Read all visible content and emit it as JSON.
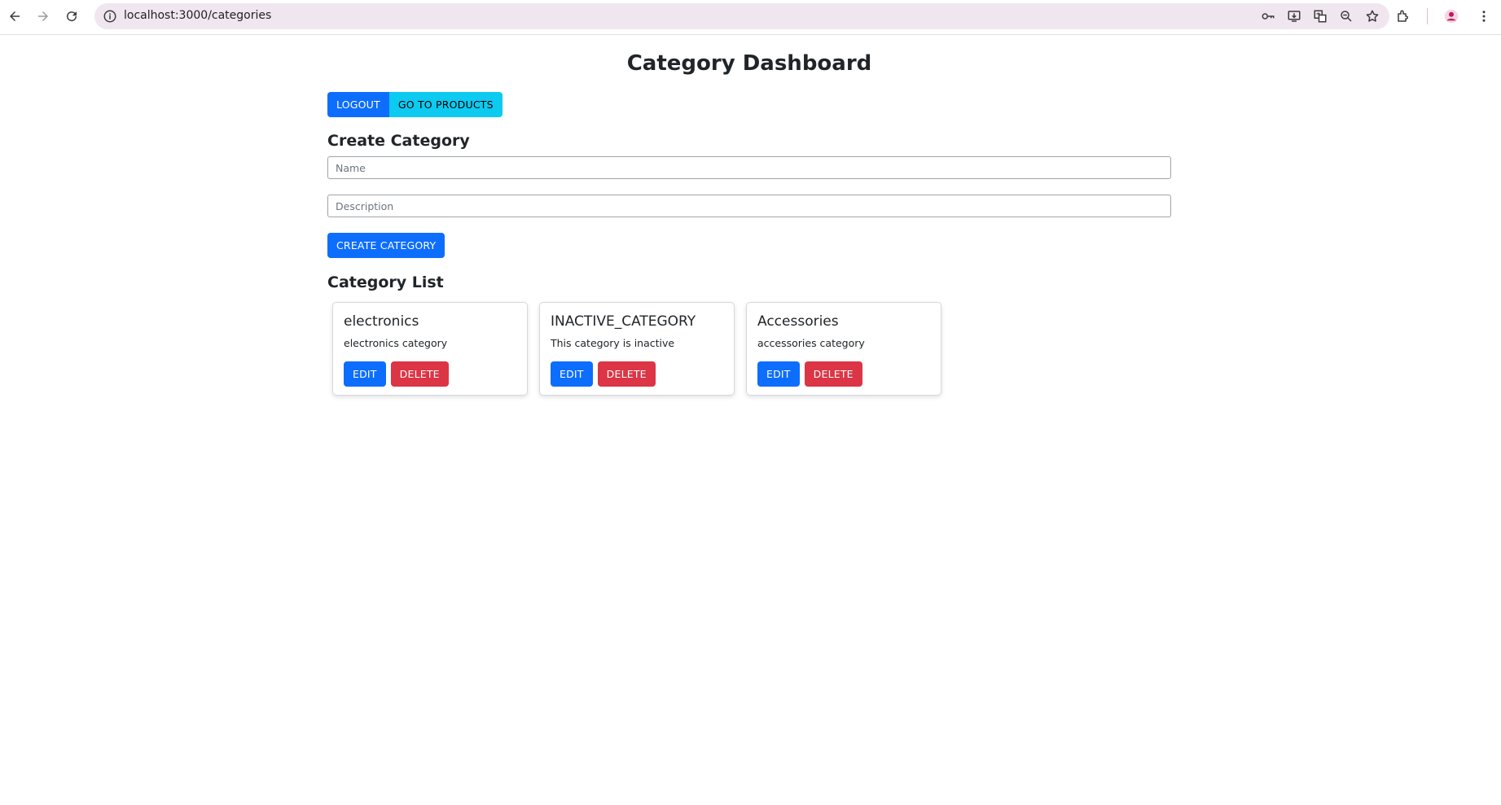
{
  "browser": {
    "url": "localhost:3000/categories",
    "icons": [
      "back-icon",
      "forward-icon",
      "reload-icon",
      "site-info-icon",
      "password-key-icon",
      "install-app-icon",
      "translate-icon",
      "zoom-icon",
      "bookmark-star-icon",
      "extensions-icon",
      "profile-avatar-icon",
      "more-menu-icon"
    ]
  },
  "page": {
    "title": "Category Dashboard",
    "logout_label": "LOGOUT",
    "products_label": "GO TO PRODUCTS"
  },
  "create": {
    "heading": "Create Category",
    "name_placeholder": "Name",
    "description_placeholder": "Description",
    "submit_label": "CREATE CATEGORY"
  },
  "list": {
    "heading": "Category List",
    "edit_label": "EDIT",
    "delete_label": "DELETE",
    "items": [
      {
        "name": "electronics",
        "description": "electronics category"
      },
      {
        "name": "INACTIVE_CATEGORY",
        "description": "This category is inactive"
      },
      {
        "name": "Accessories",
        "description": "accessories category"
      }
    ]
  },
  "colors": {
    "primary": "#0d6efd",
    "info": "#0dcaf0",
    "danger": "#dc3545",
    "omnibox": "#f0e6f0",
    "profile": "#c2185b"
  }
}
